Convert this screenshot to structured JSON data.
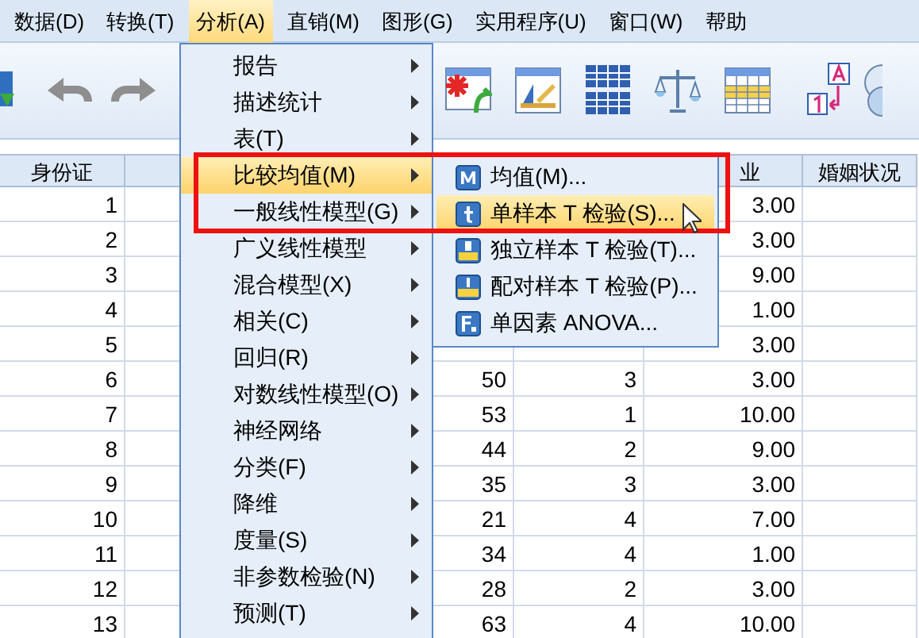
{
  "menubar": [
    {
      "label": "数据(D)",
      "selected": false
    },
    {
      "label": "转换(T)",
      "selected": false
    },
    {
      "label": "分析(A)",
      "selected": true
    },
    {
      "label": "直销(M)",
      "selected": false
    },
    {
      "label": "图形(G)",
      "selected": false
    },
    {
      "label": "实用程序(U)",
      "selected": false
    },
    {
      "label": "窗口(W)",
      "selected": false
    },
    {
      "label": "帮助",
      "selected": false
    }
  ],
  "analyze_menu": [
    {
      "label": "报告",
      "selected": false
    },
    {
      "label": "描述统计",
      "selected": false
    },
    {
      "label": "表(T)",
      "selected": false
    },
    {
      "label": "比较均值(M)",
      "selected": true
    },
    {
      "label": "一般线性模型(G)",
      "selected": false
    },
    {
      "label": "广义线性模型",
      "selected": false
    },
    {
      "label": "混合模型(X)",
      "selected": false
    },
    {
      "label": "相关(C)",
      "selected": false
    },
    {
      "label": "回归(R)",
      "selected": false
    },
    {
      "label": "对数线性模型(O)",
      "selected": false
    },
    {
      "label": "神经网络",
      "selected": false
    },
    {
      "label": "分类(F)",
      "selected": false
    },
    {
      "label": "降维",
      "selected": false
    },
    {
      "label": "度量(S)",
      "selected": false
    },
    {
      "label": "非参数检验(N)",
      "selected": false
    },
    {
      "label": "预测(T)",
      "selected": false
    }
  ],
  "compare_means_submenu": [
    {
      "label": "均值(M)...",
      "selected": false
    },
    {
      "label": "单样本 T 检验(S)...",
      "selected": true
    },
    {
      "label": "独立样本 T 检验(T)...",
      "selected": false
    },
    {
      "label": "配对样本 T 检验(P)...",
      "selected": false
    },
    {
      "label": "单因素 ANOVA...",
      "selected": false
    }
  ],
  "table": {
    "columns": [
      {
        "header": "身份证"
      },
      {},
      {},
      {},
      {},
      {
        "header": "业"
      },
      {
        "header": "婚姻状况"
      }
    ],
    "rows": [
      {
        "column_1": "1",
        "column_6": "3.00"
      },
      {
        "column_1": "2",
        "column_6": "3.00"
      },
      {
        "column_1": "3",
        "column_6": "9.00"
      },
      {
        "column_1": "4",
        "column_6": "1.00"
      },
      {
        "column_1": "5",
        "column_6": "3.00"
      },
      {
        "column_1": "6",
        "column_4": "50",
        "column_5": "3",
        "column_6": "3.00"
      },
      {
        "column_1": "7",
        "column_4": "53",
        "column_5": "1",
        "column_6": "10.00"
      },
      {
        "column_1": "8",
        "column_4": "44",
        "column_5": "2",
        "column_6": "9.00"
      },
      {
        "column_1": "9",
        "column_4": "35",
        "column_5": "3",
        "column_6": "3.00"
      },
      {
        "column_1": "10",
        "column_4": "21",
        "column_5": "4",
        "column_6": "7.00"
      },
      {
        "column_1": "11",
        "column_4": "34",
        "column_5": "4",
        "column_6": "1.00"
      },
      {
        "column_1": "12",
        "column_4": "28",
        "column_5": "2",
        "column_6": "3.00"
      },
      {
        "column_1": "13",
        "column_4": "63",
        "column_5": "4",
        "column_6": "10.00"
      }
    ]
  }
}
